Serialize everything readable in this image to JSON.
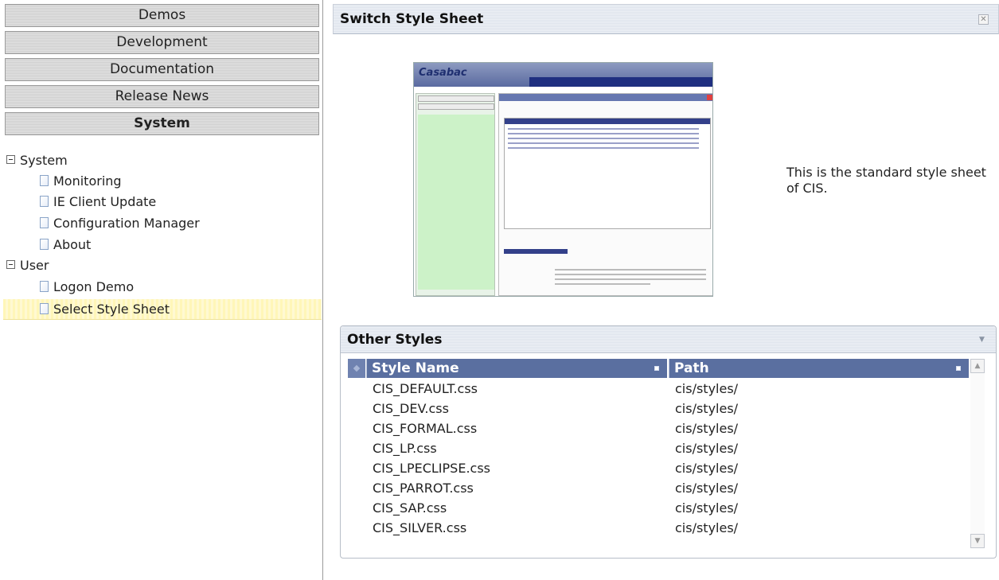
{
  "nav": {
    "sections": [
      {
        "label": "Demos"
      },
      {
        "label": "Development"
      },
      {
        "label": "Documentation"
      },
      {
        "label": "Release News"
      },
      {
        "label": "System"
      }
    ],
    "tree": {
      "system_label": "System",
      "system_items": [
        "Monitoring",
        "IE Client Update",
        "Configuration Manager",
        "About"
      ],
      "user_label": "User",
      "user_items": [
        "Logon Demo",
        "Select Style Sheet"
      ]
    }
  },
  "main": {
    "title": "Switch Style Sheet",
    "preview": {
      "logo": "Casabac",
      "description": "This is the standard style sheet of CIS."
    },
    "other_styles": {
      "title": "Other Styles",
      "columns": [
        "Style Name",
        "Path"
      ],
      "rows": [
        [
          "CIS_DEFAULT.css",
          "cis/styles/"
        ],
        [
          "CIS_DEV.css",
          "cis/styles/"
        ],
        [
          "CIS_FORMAL.css",
          "cis/styles/"
        ],
        [
          "CIS_LP.css",
          "cis/styles/"
        ],
        [
          "CIS_LPECLIPSE.css",
          "cis/styles/"
        ],
        [
          "CIS_PARROT.css",
          "cis/styles/"
        ],
        [
          "CIS_SAP.css",
          "cis/styles/"
        ],
        [
          "CIS_SILVER.css",
          "cis/styles/"
        ]
      ]
    }
  },
  "icons": {
    "close": "close-icon",
    "collapse": "collapse-icon",
    "scroll_up": "scroll-up-icon",
    "scroll_down": "scroll-down-icon",
    "tree_toggle": "minus-box-icon",
    "tree_leaf": "document-icon"
  },
  "colors": {
    "grid_header": "#5a6fa0",
    "selection": "#fff6b8",
    "preview_tree": "#ccf2c8"
  }
}
